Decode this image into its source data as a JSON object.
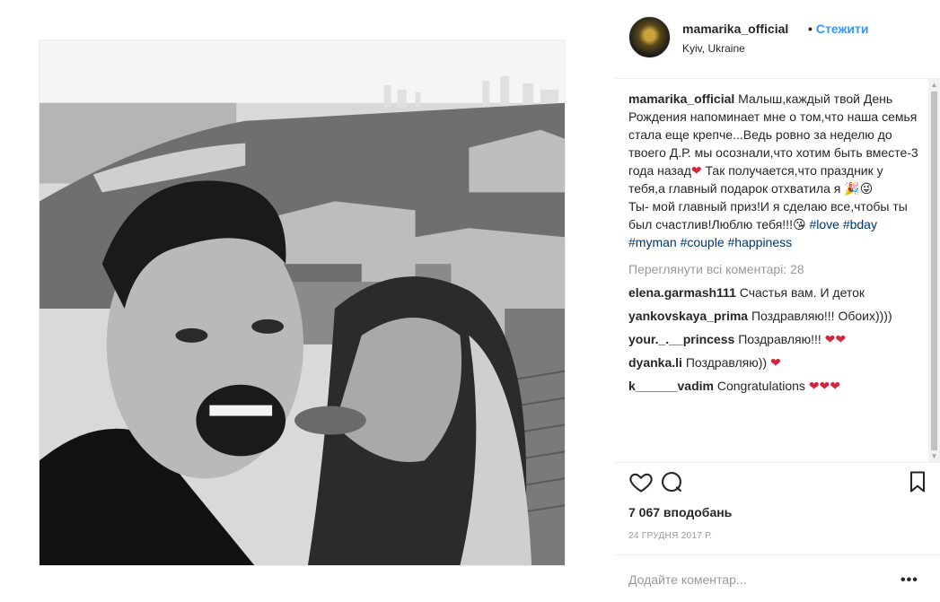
{
  "post": {
    "owner": "mamarika_official",
    "follow_label": "Стежити",
    "separator": "•",
    "location": "Kyiv, Ukraine",
    "caption_user": "mamarika_official",
    "caption_text": " Малыш,каждый твой День Рождения напоминает мне о том,что наша семья стала еще крепче...Ведь ровно за неделю до твоего Д.Р. мы осознали,что хотим быть вместе-3 года назад",
    "caption_text_2": " Так получается,что праздник у тебя,а главный подарок отхватила я ",
    "caption_text_3": "Ты- мой главный приз!И я сделаю все,чтобы ты был счастлив!Люблю тебя!!!",
    "caption_emoji_heart": "❤",
    "caption_emoji_party": "🎉",
    "caption_emoji_wink": "😜",
    "caption_emoji_kiss": "😘",
    "hashtags": [
      "#love",
      "#bday",
      "#myman",
      "#couple",
      "#happiness"
    ],
    "view_all_comments": "Переглянути всі коментарі: 28",
    "comments": [
      {
        "user": "elena.garmash111",
        "text": "Счастья вам. И деток",
        "hearts": ""
      },
      {
        "user": "yankovskaya_prima",
        "text": "Поздравляю!!! Обоих))))",
        "hearts": ""
      },
      {
        "user": "your._.__princess",
        "text": "Поздравляю!!!",
        "hearts": "❤❤"
      },
      {
        "user": "dyanka.li",
        "text": "Поздравляю))",
        "hearts": "❤"
      },
      {
        "user": "k______vadim",
        "text": "Congratulations",
        "hearts": "❤❤❤"
      }
    ],
    "likes": "7 067 вподобань",
    "date": "24 ГРУДНЯ 2017 Р.",
    "add_comment_placeholder": "Додайте коментар...",
    "more_label": "•••"
  },
  "icons": [
    "heart-icon",
    "comment-icon",
    "bookmark-icon",
    "more-icon"
  ],
  "colors": {
    "link": "#3897f0",
    "hashtag": "#003569",
    "muted": "#999999",
    "text": "#262626",
    "heart": "#d6243b"
  }
}
